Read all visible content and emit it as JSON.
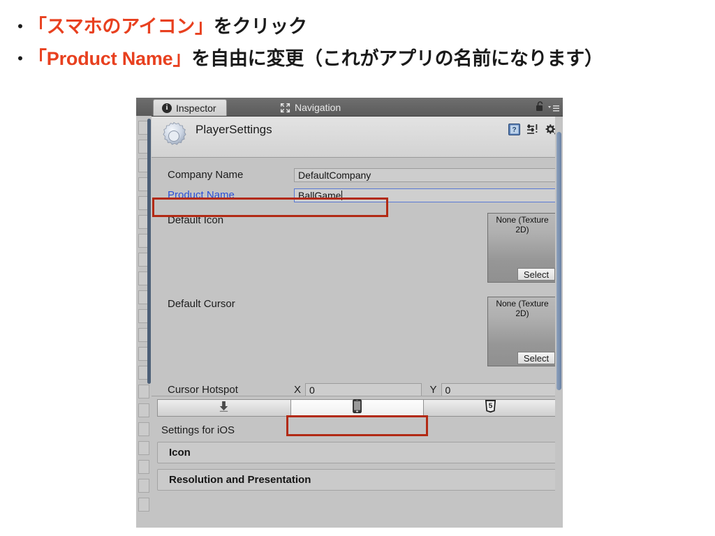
{
  "slide": {
    "bullets": [
      {
        "marker": "•",
        "pre": "",
        "highlight": "「スマホのアイコン」",
        "post": "をクリック"
      },
      {
        "marker": "•",
        "pre": "",
        "highlight": "「Product Name」",
        "post": "を自由に変更（これがアプリの名前になります）"
      }
    ]
  },
  "inspector": {
    "tabs": [
      {
        "label": "Inspector",
        "icon": "info-icon",
        "active": true
      },
      {
        "label": "Navigation",
        "icon": "navigation-icon",
        "active": false
      }
    ],
    "lock_icon": "lock-icon",
    "tab_menu_icon": "tab-menu-icon",
    "header": {
      "icon": "gear-icon",
      "title": "PlayerSettings",
      "actions": [
        {
          "name": "help-icon",
          "label": "?"
        },
        {
          "name": "preset-icon",
          "label": ""
        },
        {
          "name": "settings-gear-icon",
          "label": ""
        }
      ]
    },
    "properties": [
      {
        "label": "Company Name",
        "value": "DefaultCompany",
        "focused": false
      },
      {
        "label": "Product Name",
        "value": "BallGame",
        "focused": true
      }
    ],
    "object_fields": [
      {
        "label": "Default Icon",
        "value": "None (Texture 2D)",
        "button": "Select"
      },
      {
        "label": "Default Cursor",
        "value": "None (Texture 2D)",
        "button": "Select"
      }
    ],
    "cursor_hotspot": {
      "label": "Cursor Hotspot",
      "x_label": "X",
      "x_value": "0",
      "y_label": "Y",
      "y_value": "0"
    },
    "platform_tabs": [
      {
        "name": "standalone",
        "icon": "download-icon",
        "selected": false
      },
      {
        "name": "ios",
        "icon": "phone-icon",
        "selected": true
      },
      {
        "name": "webgl",
        "icon": "html5-icon",
        "selected": false
      }
    ],
    "settings": {
      "title": "Settings for iOS",
      "sections": [
        {
          "label": "Icon"
        },
        {
          "label": "Resolution and Presentation"
        }
      ]
    }
  },
  "colors": {
    "annotation_red": "#b22a14",
    "highlight_text": "#e8401f",
    "focused_label_blue": "#2a4fd8",
    "panel_gray": "#c4c4c4",
    "scrollbar_blue": "#6a82a4"
  }
}
